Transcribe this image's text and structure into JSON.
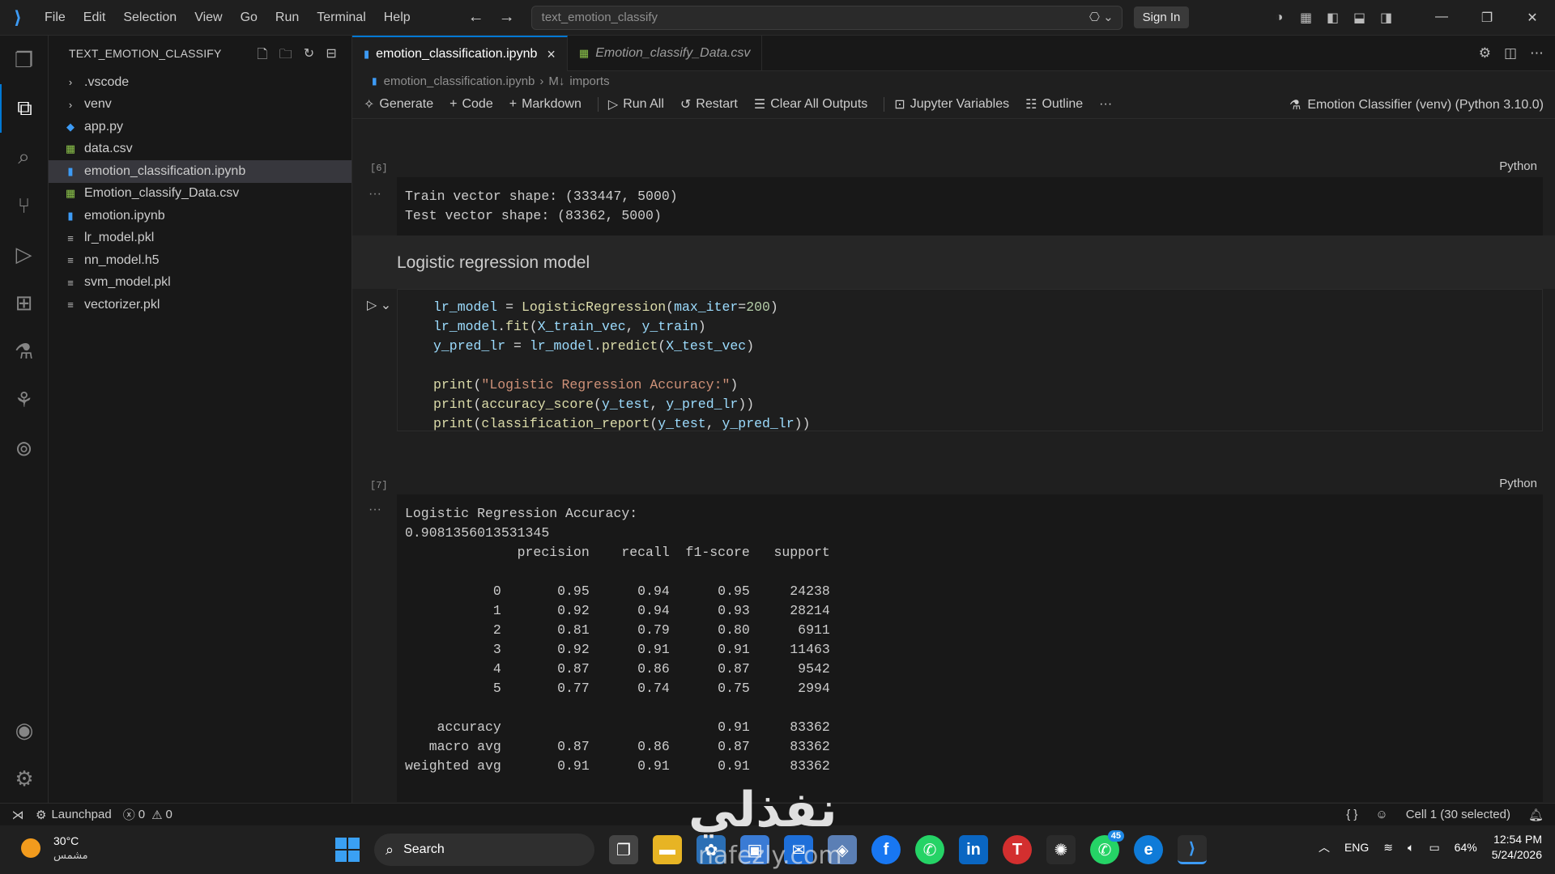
{
  "menu": [
    "File",
    "Edit",
    "Selection",
    "View",
    "Go",
    "Run",
    "Terminal",
    "Help"
  ],
  "command_center": "text_emotion_classify",
  "sign_in": "Sign In",
  "explorer": {
    "title": "TEXT_EMOTION_CLASSIFY",
    "items": [
      {
        "label": ".vscode",
        "kind": "folder"
      },
      {
        "label": "venv",
        "kind": "folder"
      },
      {
        "label": "app.py",
        "kind": "python"
      },
      {
        "label": "data.csv",
        "kind": "csv"
      },
      {
        "label": "emotion_classification.ipynb",
        "kind": "notebook"
      },
      {
        "label": "Emotion_classify_Data.csv",
        "kind": "csv"
      },
      {
        "label": "emotion.ipynb",
        "kind": "notebook"
      },
      {
        "label": "lr_model.pkl",
        "kind": "file"
      },
      {
        "label": "nn_model.h5",
        "kind": "file"
      },
      {
        "label": "svm_model.pkl",
        "kind": "file"
      },
      {
        "label": "vectorizer.pkl",
        "kind": "file"
      }
    ]
  },
  "tabs": [
    {
      "label": "emotion_classification.ipynb",
      "active": true
    },
    {
      "label": "Emotion_classify_Data.csv",
      "active": false
    }
  ],
  "breadcrumb": {
    "file": "emotion_classification.ipynb",
    "section": "imports"
  },
  "toolbar": {
    "generate": "Generate",
    "code": "Code",
    "markdown": "Markdown",
    "run_all": "Run All",
    "restart": "Restart",
    "clear_outputs": "Clear All Outputs",
    "variables": "Jupyter Variables",
    "outline": "Outline",
    "more": "···",
    "kernel": "Emotion Classifier (venv) (Python 3.10.0)"
  },
  "cells": {
    "cell6_exec": "[6]",
    "lang": "Python",
    "out6": "Train vector shape: (333447, 5000)\nTest vector shape: (83362, 5000)",
    "markdown_heading": "Logistic regression model",
    "cell7_exec": "[7]",
    "out7": "Logistic Regression Accuracy:\n0.9081356013531345\n              precision    recall  f1-score   support\n\n           0       0.95      0.94      0.95     24238\n           1       0.92      0.94      0.93     28214\n           2       0.81      0.79      0.80      6911\n           3       0.92      0.91      0.91     11463\n           4       0.87      0.86      0.87      9542\n           5       0.77      0.74      0.75      2994\n\n    accuracy                           0.91     83362\n   macro avg       0.87      0.86      0.87     83362\nweighted avg       0.91      0.91      0.91     83362"
  },
  "status": {
    "launchpad": "Launchpad",
    "errors": "0",
    "warnings": "0",
    "braces": "{ }",
    "cell": "Cell 1 (30 selected)"
  },
  "taskbar": {
    "temp": "30°C",
    "weather": "مشمس",
    "search": "Search",
    "lang": "ENG",
    "battery": "64%",
    "time": "12:54 PM",
    "date": "5/24/2026",
    "badge": "45"
  },
  "watermark": {
    "arabic": "نفذلي",
    "latin": "nafezly.com"
  }
}
